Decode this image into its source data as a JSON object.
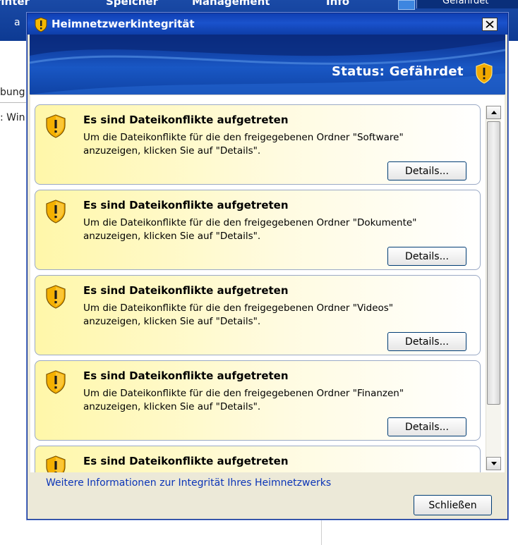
{
  "background": {
    "menu": [
      "rinter",
      "Speicher",
      "Management",
      "Info"
    ],
    "right_button": "Gefährdet",
    "toolbar_label": "a",
    "side_texts": [
      "bung",
      ": Win"
    ]
  },
  "dialog": {
    "title": "Heimnetzwerkintegrität",
    "status": "Status: Gefährdet",
    "cards": [
      {
        "title": "Es sind Dateikonflikte aufgetreten",
        "description": "Um die Dateikonflikte für die den freigegebenen Ordner \"Software\" anzuzeigen, klicken Sie auf \"Details\".",
        "button": "Details..."
      },
      {
        "title": "Es sind Dateikonflikte aufgetreten",
        "description": "Um die Dateikonflikte für die den freigegebenen Ordner \"Dokumente\" anzuzeigen, klicken Sie auf \"Details\".",
        "button": "Details..."
      },
      {
        "title": "Es sind Dateikonflikte aufgetreten",
        "description": "Um die Dateikonflikte für die den freigegebenen Ordner \"Videos\" anzuzeigen, klicken Sie auf \"Details\".",
        "button": "Details..."
      },
      {
        "title": "Es sind Dateikonflikte aufgetreten",
        "description": "Um die Dateikonflikte für die den freigegebenen Ordner \"Finanzen\" anzuzeigen, klicken Sie auf \"Details\".",
        "button": "Details..."
      },
      {
        "title": "Es sind Dateikonflikte aufgetreten",
        "description": "",
        "button": ""
      }
    ],
    "info_link": "Weitere Informationen zur Integrität Ihres Heimnetzwerks",
    "close_button": "Schließen"
  },
  "colors": {
    "titlebar": "#1a52cc",
    "card_yellow": "#fff7a9",
    "link": "#0b34b7",
    "warning_shield": "#f0b400"
  }
}
